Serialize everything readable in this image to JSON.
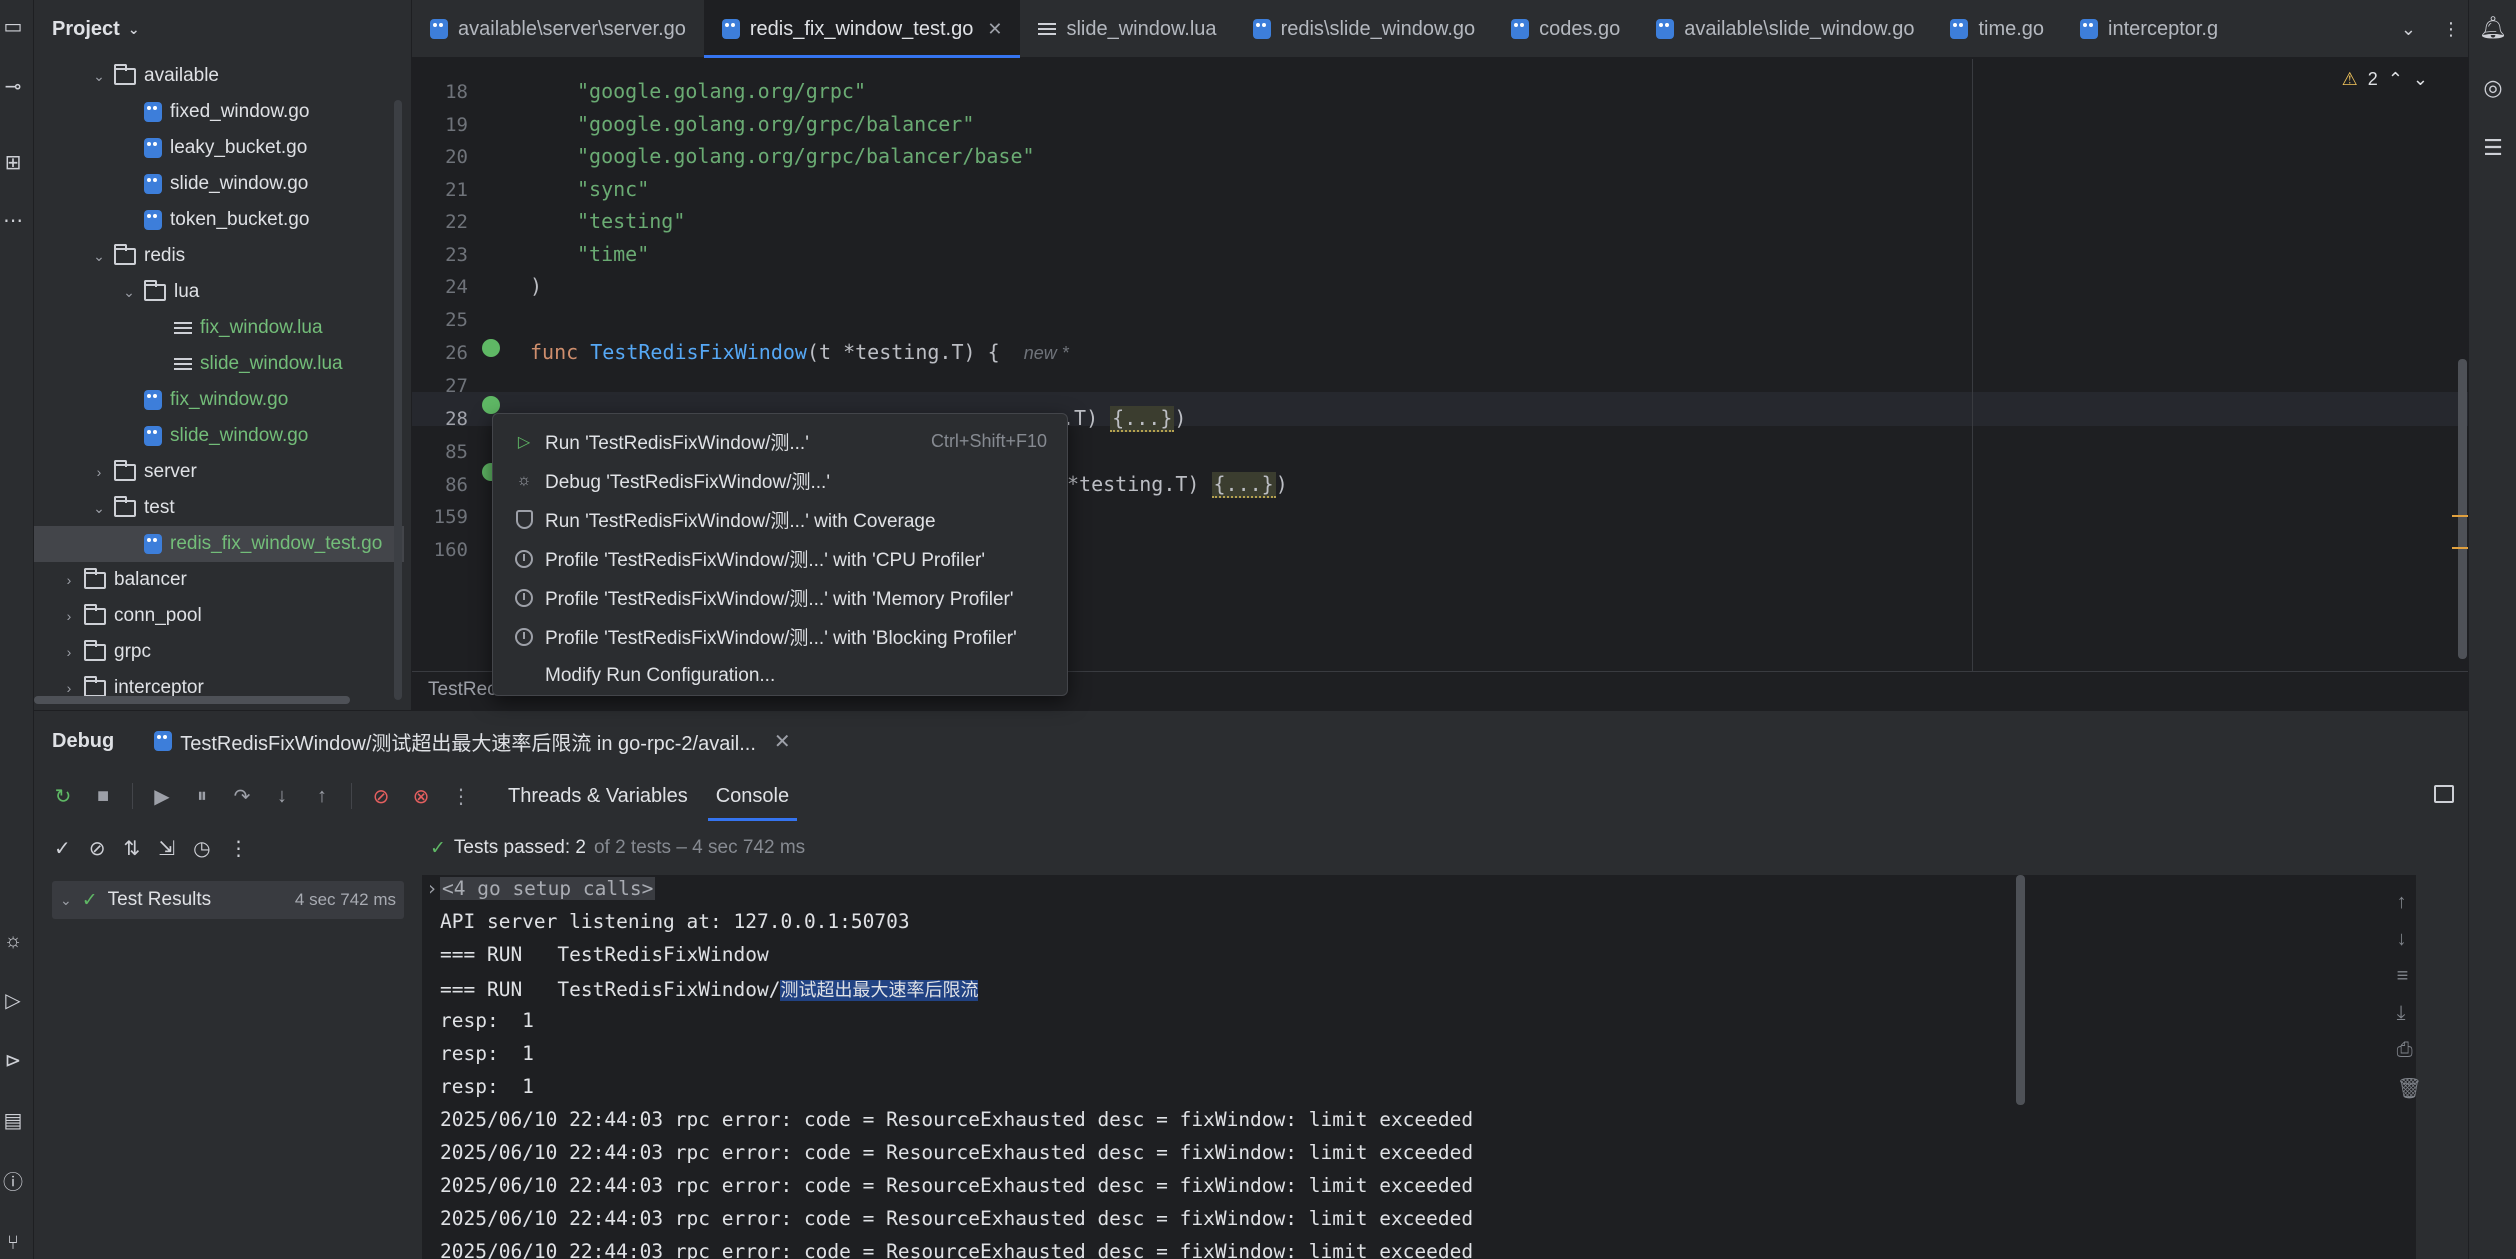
{
  "project": {
    "title": "Project",
    "tree": [
      {
        "label": "available",
        "type": "folder",
        "depth": 2,
        "expanded": true,
        "color": "normal"
      },
      {
        "label": "fixed_window.go",
        "type": "go",
        "depth": 3,
        "color": "normal"
      },
      {
        "label": "leaky_bucket.go",
        "type": "go",
        "depth": 3,
        "color": "normal"
      },
      {
        "label": "slide_window.go",
        "type": "go",
        "depth": 3,
        "color": "normal"
      },
      {
        "label": "token_bucket.go",
        "type": "go",
        "depth": 3,
        "color": "normal"
      },
      {
        "label": "redis",
        "type": "folder",
        "depth": 2,
        "expanded": true,
        "color": "normal"
      },
      {
        "label": "lua",
        "type": "folder",
        "depth": 3,
        "expanded": true,
        "color": "normal"
      },
      {
        "label": "fix_window.lua",
        "type": "lua",
        "depth": 4,
        "color": "green"
      },
      {
        "label": "slide_window.lua",
        "type": "lua",
        "depth": 4,
        "color": "green"
      },
      {
        "label": "fix_window.go",
        "type": "go",
        "depth": 3,
        "color": "green"
      },
      {
        "label": "slide_window.go",
        "type": "go",
        "depth": 3,
        "color": "green"
      },
      {
        "label": "server",
        "type": "folder",
        "depth": 2,
        "expanded": false,
        "color": "normal"
      },
      {
        "label": "test",
        "type": "folder",
        "depth": 2,
        "expanded": true,
        "color": "normal"
      },
      {
        "label": "redis_fix_window_test.go",
        "type": "go",
        "depth": 3,
        "color": "green",
        "selected": true
      },
      {
        "label": "balancer",
        "type": "folder",
        "depth": 1,
        "expanded": false,
        "color": "normal"
      },
      {
        "label": "conn_pool",
        "type": "folder",
        "depth": 1,
        "expanded": false,
        "color": "normal"
      },
      {
        "label": "grpc",
        "type": "folder",
        "depth": 1,
        "expanded": false,
        "color": "normal"
      },
      {
        "label": "interceptor",
        "type": "folder",
        "depth": 1,
        "expanded": false,
        "color": "normal"
      }
    ]
  },
  "tabs": [
    {
      "label": "available\\server\\server.go",
      "icon": "go-file-icon"
    },
    {
      "label": "redis_fix_window_test.go",
      "icon": "go-file-icon",
      "active": true
    },
    {
      "label": "slide_window.lua",
      "icon": "lua-file-icon"
    },
    {
      "label": "redis\\slide_window.go",
      "icon": "go-file-icon"
    },
    {
      "label": "codes.go",
      "icon": "go-file-icon"
    },
    {
      "label": "available\\slide_window.go",
      "icon": "go-file-icon"
    },
    {
      "label": "time.go",
      "icon": "go-file-icon"
    },
    {
      "label": "interceptor.g",
      "icon": "go-file-icon"
    }
  ],
  "editor": {
    "warnings": "2",
    "lines": [
      {
        "n": "18",
        "code": "\"google.golang.org/grpc\""
      },
      {
        "n": "19",
        "code": "\"google.golang.org/grpc/balancer\""
      },
      {
        "n": "20",
        "code": "\"google.golang.org/grpc/balancer/base\""
      },
      {
        "n": "21",
        "code": "\"sync\""
      },
      {
        "n": "22",
        "code": "\"testing\""
      },
      {
        "n": "23",
        "code": "\"time\""
      },
      {
        "n": "24",
        "code": ")"
      },
      {
        "n": "25",
        "code": ""
      },
      {
        "n": "26",
        "code": "func TestRedisFixWindow(t *testing.T) {"
      },
      {
        "n": "27",
        "code": ""
      },
      {
        "n": "28",
        "code": ""
      },
      {
        "n": "85",
        "code": ""
      },
      {
        "n": "86",
        "code": ""
      },
      {
        "n": "159",
        "code": ""
      },
      {
        "n": "160",
        "code": ""
      }
    ],
    "func_keyword": "func",
    "func_name": "TestRedisFixWindow",
    "func_params": "(t *testing.T) {",
    "inlay_hint": "new *",
    "line28_tail": ".T)",
    "line28_fold": "{...}",
    "line28_close": ")",
    "line86_tail": "*testing.T)",
    "line86_fold": "{...}",
    "line86_close": ")",
    "breadcrumb": "TestRec"
  },
  "context_menu": {
    "items": [
      {
        "label": "Run 'TestRedisFixWindow/测...'",
        "shortcut": "Ctrl+Shift+F10",
        "icon": "run-icon"
      },
      {
        "label": "Debug 'TestRedisFixWindow/测...'",
        "shortcut": "",
        "icon": "debug-icon"
      },
      {
        "label": "Run 'TestRedisFixWindow/测...' with Coverage",
        "shortcut": "",
        "icon": "coverage-icon"
      },
      {
        "label": "Profile 'TestRedisFixWindow/测...' with 'CPU Profiler'",
        "shortcut": "",
        "icon": "profiler-icon"
      },
      {
        "label": "Profile 'TestRedisFixWindow/测...' with 'Memory Profiler'",
        "shortcut": "",
        "icon": "profiler-icon"
      },
      {
        "label": "Profile 'TestRedisFixWindow/测...' with 'Blocking Profiler'",
        "shortcut": "",
        "icon": "profiler-icon"
      },
      {
        "label": "Modify Run Configuration...",
        "shortcut": "",
        "icon": ""
      }
    ]
  },
  "debug": {
    "title": "Debug",
    "session": "TestRedisFixWindow/测试超出最大速率后限流 in go-rpc-2/avail...",
    "sub_tabs": [
      "Threads & Variables",
      "Console"
    ],
    "active_sub_tab": "Console",
    "status_bold": "Tests passed: 2",
    "status_rest": "of 2 tests – 4 sec 742 ms",
    "results_label": "Test Results",
    "results_time": "4 sec 742 ms",
    "console": {
      "setup": "<4 go setup calls>",
      "listen": "API server listening at: 127.0.0.1:50703",
      "run1": "=== RUN   TestRedisFixWindow",
      "run2_prefix": "=== RUN   TestRedisFixWindow/",
      "run2_sel": "测试超出最大速率后限流",
      "resp": [
        "resp:  1",
        "resp:  1",
        "resp:  1"
      ],
      "errors": [
        "2025/06/10 22:44:03 rpc error: code = ResourceExhausted desc = fixWindow: limit exceeded",
        "2025/06/10 22:44:03 rpc error: code = ResourceExhausted desc = fixWindow: limit exceeded",
        "2025/06/10 22:44:03 rpc error: code = ResourceExhausted desc = fixWindow: limit exceeded",
        "2025/06/10 22:44:03 rpc error: code = ResourceExhausted desc = fixWindow: limit exceeded",
        "2025/06/10 22:44:03 rpc error: code = ResourceExhausted desc = fixWindow: limit exceeded"
      ]
    }
  },
  "colors": {
    "accent": "#3574f0",
    "green": "#73bd79",
    "string": "#6aab73",
    "keyword": "#cf8e6d",
    "function": "#56a8f5"
  }
}
